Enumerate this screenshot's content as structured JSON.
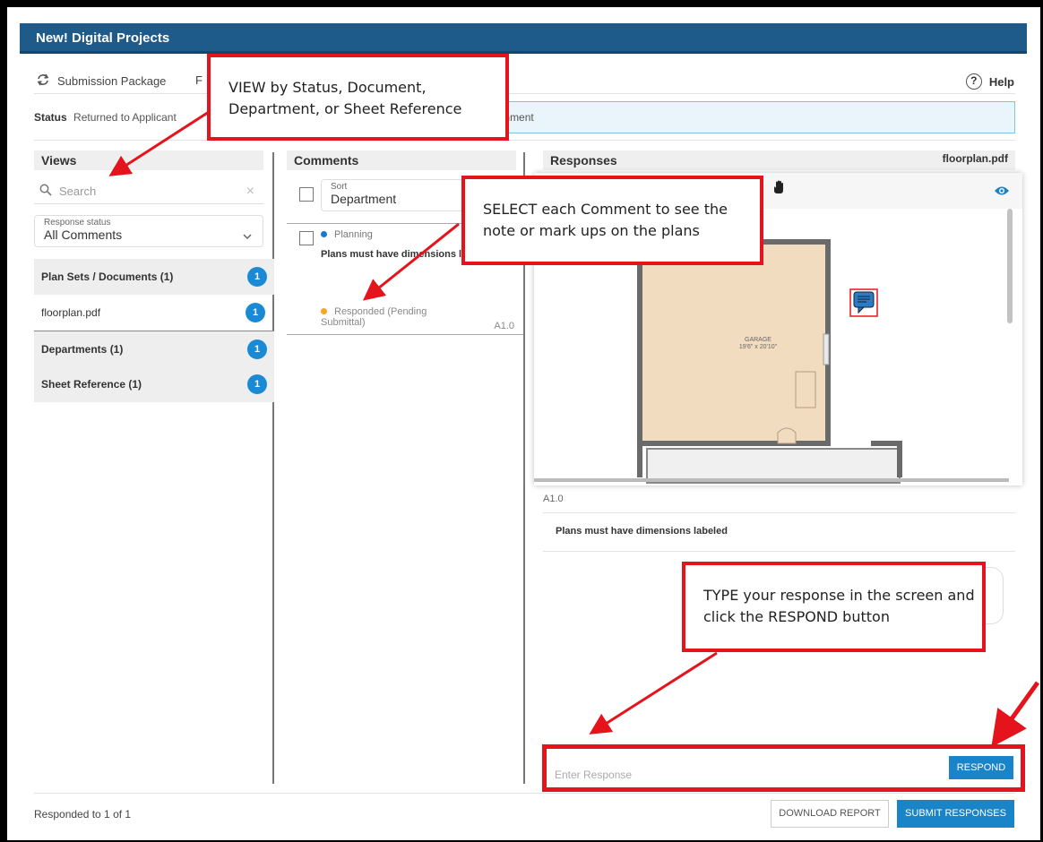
{
  "app": {
    "title": "New! Digital Projects"
  },
  "toolbar": {
    "submission_label": "Submission Package",
    "tab_partial": "F",
    "help_label": "Help"
  },
  "status": {
    "label": "Status",
    "value": "Returned to Applicant",
    "info_text": "response for each comment"
  },
  "views": {
    "title": "Views",
    "search_placeholder": "Search",
    "response_status_label": "Response status",
    "response_status_value": "All Comments",
    "items": [
      {
        "label": "Plan Sets / Documents (1)",
        "count": "1"
      },
      {
        "label": "floorplan.pdf",
        "count": "1"
      },
      {
        "label": "Departments (1)",
        "count": "1"
      },
      {
        "label": "Sheet Reference (1)",
        "count": "1"
      }
    ]
  },
  "comments": {
    "title": "Comments",
    "sort_label": "Sort",
    "sort_value": "Department",
    "card": {
      "department": "Planning",
      "text": "Plans must have dimensions labeled",
      "status": "Responded (Pending Submittal)",
      "sheet": "A1.0"
    }
  },
  "responses": {
    "title": "Responses",
    "file_name": "floorplan.pdf",
    "room_label": "GARAGE",
    "room_dims": "19'6\" x 20'10\"",
    "sheet": "A1.0",
    "comment_text": "Plans must have dimensions labeled",
    "input_placeholder": "Enter Response",
    "respond_label": "RESPOND"
  },
  "footer": {
    "responded_text": "Responded to 1 of 1",
    "download_label": "DOWNLOAD REPORT",
    "submit_label": "SUBMIT RESPONSES"
  },
  "annotations": {
    "view": "VIEW by Status, Document, Department, or Sheet Reference",
    "select": "SELECT each Comment to see the note or mark ups on the plans",
    "type": "TYPE your response in the screen and click the RESPOND button"
  },
  "colors": {
    "header": "#1f5b8a",
    "accent": "#1a84c8",
    "annotation": "#e5131c",
    "room_fill": "#f2dcc0",
    "planning_dot": "#1976d2",
    "pending_dot": "#f5a623"
  },
  "icons": [
    "sync-icon",
    "help-icon",
    "search-icon",
    "clear-icon",
    "chevron-down-icon",
    "hand-icon",
    "eye-icon",
    "comment-marker-icon"
  ]
}
